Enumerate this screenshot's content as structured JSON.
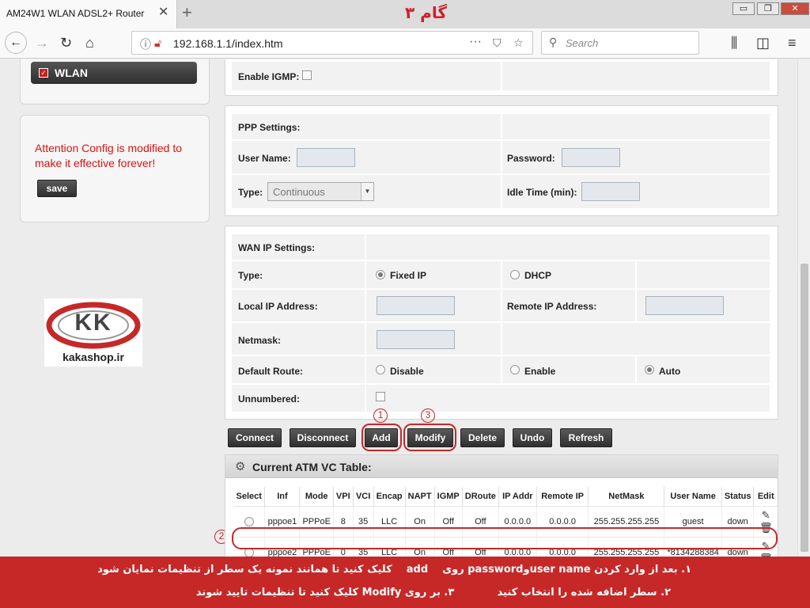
{
  "browser": {
    "tab_title": "AM24W1 WLAN ADSL2+ Router",
    "url": "192.168.1.1/index.htm",
    "search_placeholder": "Search",
    "overlay_title": "گام ۳",
    "window_buttons": {
      "minimize": "▭",
      "maximize": "❐",
      "close": "✕"
    },
    "icons": {
      "back": "back-arrow-icon",
      "forward": "forward-arrow-icon",
      "reload": "reload-icon",
      "home": "home-icon",
      "info": "info-icon",
      "insecure": "insecure-lock-icon",
      "more": "more-icon",
      "pocket": "pocket-icon",
      "bookmark": "bookmark-star-icon",
      "library": "library-icon",
      "sidebar": "sidebar-icon",
      "menu": "hamburger-menu-icon"
    }
  },
  "sidebar": {
    "menu_item": "WLAN",
    "attention_text": "Attention Config is modified to make it effective forever!",
    "save_label": "save",
    "logo_letters": "KK",
    "logo_caption": "kakashop.ir"
  },
  "igmp": {
    "label": "Enable IGMP:",
    "checked": false
  },
  "ppp": {
    "header": "PPP Settings:",
    "user_name_label": "User Name:",
    "password_label": "Password:",
    "type_label": "Type:",
    "type_value": "Continuous",
    "idle_label": "Idle Time (min):"
  },
  "wan": {
    "header": "WAN IP Settings:",
    "type_label": "Type:",
    "type_options": [
      "Fixed IP",
      "DHCP"
    ],
    "type_selected": "Fixed IP",
    "local_ip_label": "Local IP Address:",
    "remote_ip_label": "Remote IP Address:",
    "netmask_label": "Netmask:",
    "default_route_label": "Default Route:",
    "default_route_options": [
      "Disable",
      "Enable",
      "Auto"
    ],
    "default_route_selected": "Auto",
    "unnumbered_label": "Unnumbered:"
  },
  "actions": [
    "Connect",
    "Disconnect",
    "Add",
    "Modify",
    "Delete",
    "Undo",
    "Refresh"
  ],
  "step_markers": [
    "1",
    "2",
    "3"
  ],
  "atm_table": {
    "title": "Current ATM VC Table:",
    "columns": [
      "Select",
      "Inf",
      "Mode",
      "VPI",
      "VCI",
      "Encap",
      "NAPT",
      "IGMP",
      "DRoute",
      "IP Addr",
      "Remote IP",
      "NetMask",
      "User Name",
      "Status",
      "Edit"
    ],
    "rows": [
      [
        "",
        "pppoe1",
        "PPPoE",
        "8",
        "35",
        "LLC",
        "On",
        "Off",
        "Off",
        "0.0.0.0",
        "0.0.0.0",
        "255.255.255.255",
        "guest",
        "down",
        ""
      ],
      [
        "",
        "pppoe2",
        "PPPoE",
        "0",
        "35",
        "LLC",
        "On",
        "Off",
        "Off",
        "0.0.0.0",
        "0.0.0.0",
        "255.255.255.255",
        "*8134288384",
        "down",
        ""
      ]
    ]
  },
  "banner": {
    "line1_part1": "۱. بعد از وارد کردن",
    "line1_bold1": "user name",
    "line1_part2": "و",
    "line1_bold2": "password",
    "line1_part3": "روی",
    "line1_bold3": "add",
    "line1_part4": "کلیک کنید تا همانند نمونه یک سطر از تنظیمات نمایان شود",
    "line2_part1": "۲. سطر اضافه شده را انتخاب کنید",
    "line2_part2": "۳. بر روی",
    "line2_bold": "Modify",
    "line2_part3": "کلیک کنید تا تنظیمات تایید شوند"
  }
}
